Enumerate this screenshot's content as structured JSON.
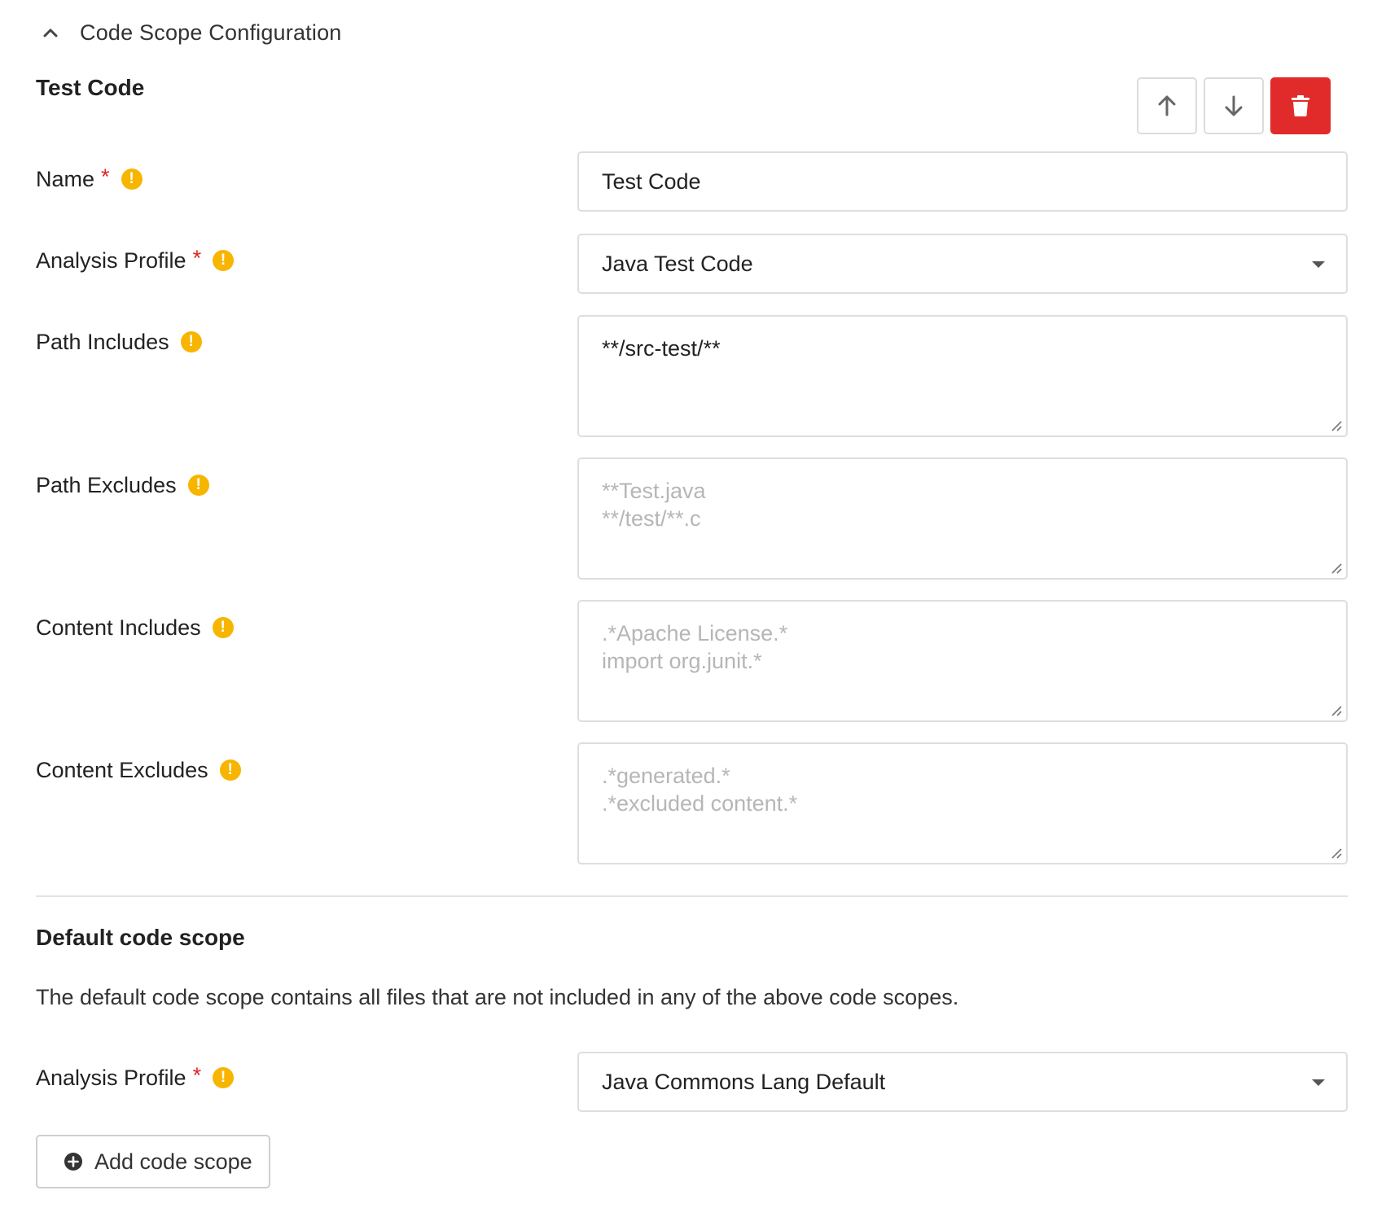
{
  "header": {
    "title": "Code Scope Configuration",
    "collapse_icon": "chevron-up-icon"
  },
  "test_code": {
    "title": "Test Code",
    "toolbar": {
      "move_up_icon": "arrow-up-icon",
      "move_down_icon": "arrow-down-icon",
      "delete_icon": "trash-icon",
      "delete_color": "#e12b2b"
    },
    "fields": {
      "name": {
        "label": "Name",
        "required": "*",
        "value": "Test Code"
      },
      "analysis_profile": {
        "label": "Analysis Profile",
        "required": "*",
        "value": "Java Test Code"
      },
      "path_includes": {
        "label": "Path Includes",
        "value": "**/src-test/**"
      },
      "path_excludes": {
        "label": "Path Excludes",
        "placeholder": "**Test.java\n**/test/**.c"
      },
      "content_includes": {
        "label": "Content Includes",
        "placeholder": ".*Apache License.*\nimport org.junit.*"
      },
      "content_excludes": {
        "label": "Content Excludes",
        "placeholder": ".*generated.*\n.*excluded content.*"
      }
    }
  },
  "default_scope": {
    "title": "Default code scope",
    "description": "The default code scope contains all files that are not included in any of the above code scopes.",
    "analysis_profile": {
      "label": "Analysis Profile",
      "required": "*",
      "value": "Java Commons Lang Default"
    }
  },
  "add_button": {
    "label": "Add code scope",
    "icon": "plus-circle-icon"
  },
  "colors": {
    "required": "#e02424",
    "info_badge": "#f7b500",
    "border": "#dedede",
    "placeholder": "#b6b6b6"
  },
  "info_badge_glyph": "!"
}
